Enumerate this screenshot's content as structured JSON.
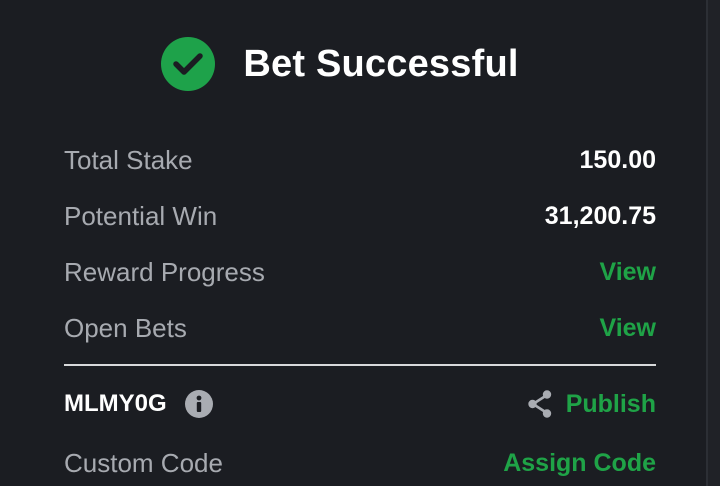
{
  "header": {
    "icon": "check-circle-icon",
    "title": "Bet Successful"
  },
  "summary": {
    "total_stake_label": "Total Stake",
    "total_stake_value": "150.00",
    "potential_win_label": "Potential Win",
    "potential_win_value": "31,200.75",
    "reward_progress_label": "Reward Progress",
    "reward_progress_link": "View",
    "open_bets_label": "Open Bets",
    "open_bets_link": "View"
  },
  "booking": {
    "code": "MLMY0G",
    "info_icon": "info-icon",
    "share_icon": "share-icon",
    "publish_label": "Publish",
    "custom_code_label": "Custom Code",
    "assign_code_label": "Assign Code"
  },
  "colors": {
    "background": "#1b1d22",
    "accent_green": "#1fa347",
    "text_primary": "#ffffff",
    "text_secondary": "#a7aab0"
  }
}
